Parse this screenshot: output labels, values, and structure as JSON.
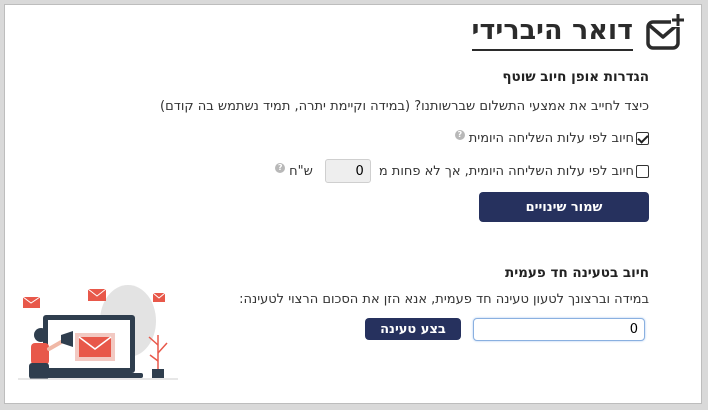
{
  "header": {
    "title": "דואר היברידי"
  },
  "billing": {
    "heading": "הגדרות אופן חיוב שוטף",
    "question": "כיצד לחייב את אמצעי התשלום שברשותנו? (במידה וקיימת יתרה, תמיד נשתמש בה קודם)",
    "option1": {
      "label": "חיוב לפי עלות השליחה היומית",
      "checked": true,
      "help": "?"
    },
    "option2": {
      "label": "חיוב לפי עלות השליחה היומית, אך לא פחות מ",
      "value": "0",
      "unit": "ש\"ח",
      "checked": false,
      "help": "?"
    },
    "save_label": "שמור שינויים"
  },
  "topup": {
    "heading": "חיוב בטעינה חד פעמית",
    "description": "במידה וברצונך לטעון טעינה חד פעמית, אנא הזן את הסכום הרצוי לטעינה:",
    "amount": "0",
    "button_label": "בצע טעינה"
  },
  "colors": {
    "primary": "#26315e",
    "accent": "#e8584a",
    "background": "#d9d9d9"
  },
  "icons": [
    "mail-plus-icon",
    "help-icon",
    "marketing-illustration"
  ]
}
